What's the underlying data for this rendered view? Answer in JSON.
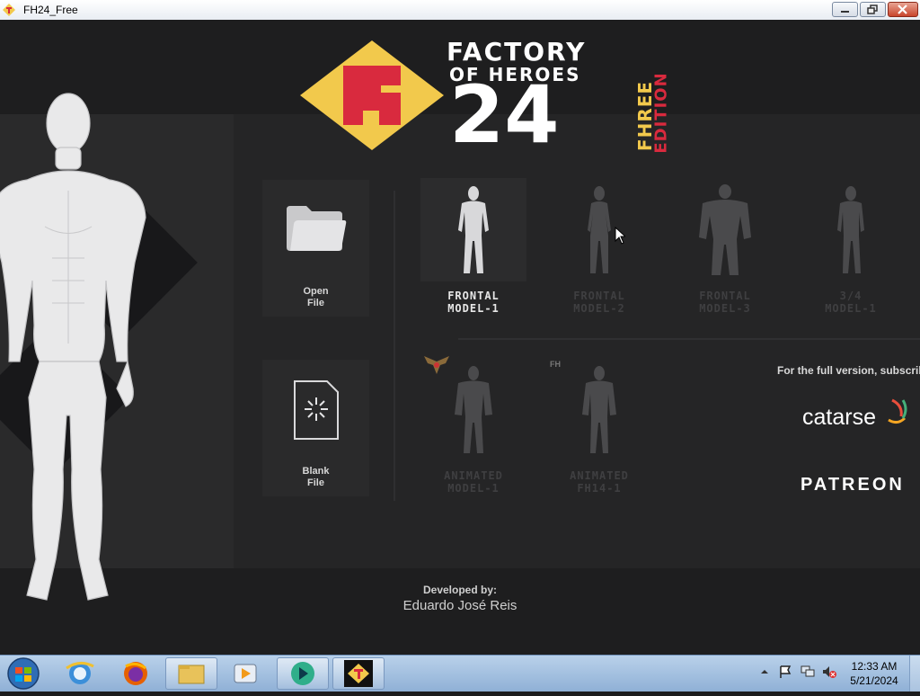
{
  "window": {
    "title": "FH24_Free"
  },
  "logo": {
    "line1": "FACTORY",
    "line2": "OF HEROES",
    "number": "24",
    "edition_word1": "FHREE",
    "edition_word2": "EDITION"
  },
  "actions": [
    {
      "label": "Open\nFile",
      "icon": "folder-icon"
    },
    {
      "label": "Blank\nFile",
      "icon": "blank-file-icon"
    }
  ],
  "models": [
    {
      "label": "FRONTAL\nMODEL-1",
      "active": true
    },
    {
      "label": "FRONTAL\nMODEL-2",
      "active": false
    },
    {
      "label": "FRONTAL\nMODEL-3",
      "active": false
    },
    {
      "label": "3/4\nMODEL-1",
      "active": false
    },
    {
      "label": "ANIMATED\nMODEL-1",
      "active": false,
      "badge": "wings-badge-icon"
    },
    {
      "label": "ANIMATED\nFH14-1",
      "active": false,
      "badge": "FH"
    }
  ],
  "promo": {
    "text": "For the full version, subscrib",
    "catarse": "catarse",
    "patreon": "PATREON"
  },
  "credits": {
    "label": "Developed by:",
    "name": "Eduardo José Reis"
  },
  "colors": {
    "logo_red": "#d92a3e",
    "logo_yellow": "#f2c94c",
    "bg": "#1e1e1f"
  },
  "taskbar": {
    "items": [
      "start-orb-icon",
      "internet-explorer-icon",
      "firefox-icon",
      "file-explorer-icon",
      "media-player-icon",
      "app-icon",
      "fh24-icon"
    ],
    "clock_time": "12:33 AM",
    "clock_date": "5/21/2024"
  }
}
